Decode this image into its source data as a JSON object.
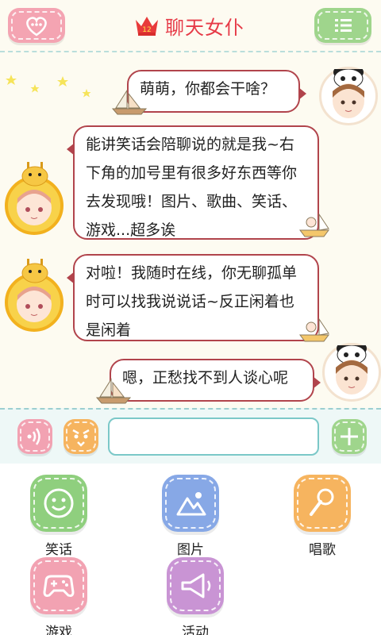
{
  "header": {
    "title": "聊天女仆",
    "crown_number": "12",
    "left_button_icon": "chat-heart-icon",
    "right_button_icon": "menu-icon"
  },
  "messages": [
    {
      "side": "right",
      "text": "萌萌，你都会干啥？"
    },
    {
      "side": "left",
      "lines": [
        "能讲笑话会陪聊说的就是我~右",
        "下角的加号里有很多好东西等你",
        "去发现哦！图片、歌曲、笑话、",
        "游戏...超多诶"
      ]
    },
    {
      "side": "left",
      "lines": [
        "对啦！我随时在线，你无聊孤单",
        "时可以找我说说话~反正闲着也",
        "是闲着"
      ]
    },
    {
      "side": "right",
      "text": "嗯，正愁找不到人谈心呢"
    }
  ],
  "input": {
    "placeholder": "",
    "value": ""
  },
  "features": [
    {
      "label": "笑话",
      "icon": "smiley-icon",
      "color": "#8fcf7e"
    },
    {
      "label": "图片",
      "icon": "picture-icon",
      "color": "#87a8e6"
    },
    {
      "label": "唱歌",
      "icon": "microphone-icon",
      "color": "#f6b45f"
    },
    {
      "label": "游戏",
      "icon": "gamepad-icon",
      "color": "#f2a2b2"
    },
    {
      "label": "活动",
      "icon": "megaphone-icon",
      "color": "#c994d4"
    }
  ],
  "colors": {
    "accent_red": "#e63a47",
    "bubble_border": "#b1444c",
    "teal": "#7bc8c8"
  }
}
